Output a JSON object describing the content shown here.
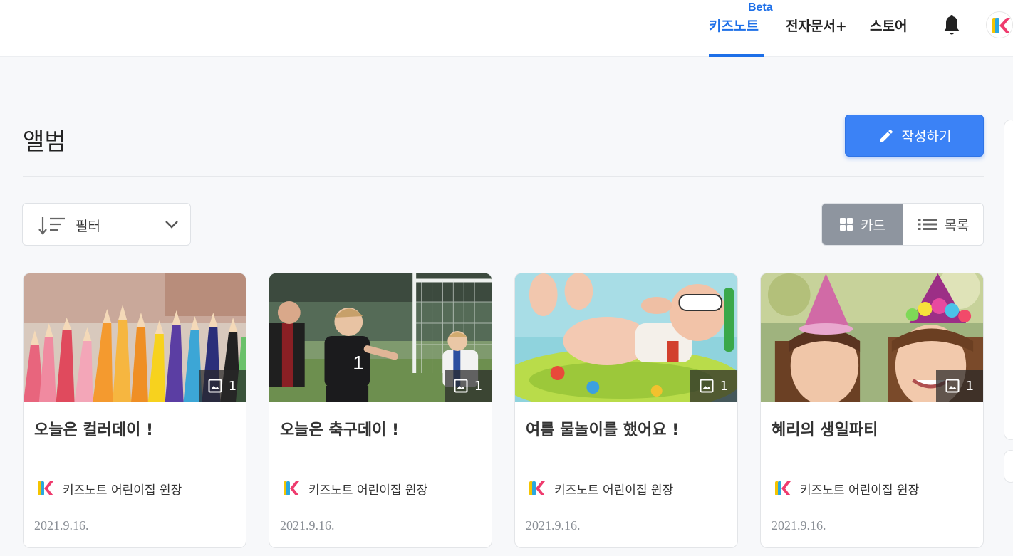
{
  "header": {
    "nav": [
      {
        "label": "키즈노트",
        "active": true
      },
      {
        "label": "전자문서+",
        "active": false
      },
      {
        "label": "스토어",
        "active": false
      }
    ],
    "beta_label": "Beta",
    "icons": [
      "bell-icon",
      "kidsnote-logo"
    ],
    "accent_color": "#1d6fe8"
  },
  "page": {
    "title": "앨범",
    "write_button": "작성하기"
  },
  "filter": {
    "label": "필터"
  },
  "view_toggle": {
    "card_label": "카드",
    "list_label": "목록",
    "selected": "카드"
  },
  "cards": [
    {
      "title": "오늘은 컬러데이 !",
      "author": "키즈노트 어린이집 원장",
      "date": "2021.9.16.",
      "photo_count": "1",
      "image": "colored-pencils"
    },
    {
      "title": "오늘은 축구데이 !",
      "author": "키즈노트 어린이집 원장",
      "date": "2021.9.16.",
      "photo_count": "1",
      "image": "kids-soccer"
    },
    {
      "title": "여름 물놀이를 했어요 !",
      "author": "키즈노트 어린이집 원장",
      "date": "2021.9.16.",
      "photo_count": "1",
      "image": "baby-pool-float"
    },
    {
      "title": "혜리의 생일파티",
      "author": "키즈노트 어린이집 원장",
      "date": "2021.9.16.",
      "photo_count": "1",
      "image": "birthday-party-hats"
    }
  ]
}
